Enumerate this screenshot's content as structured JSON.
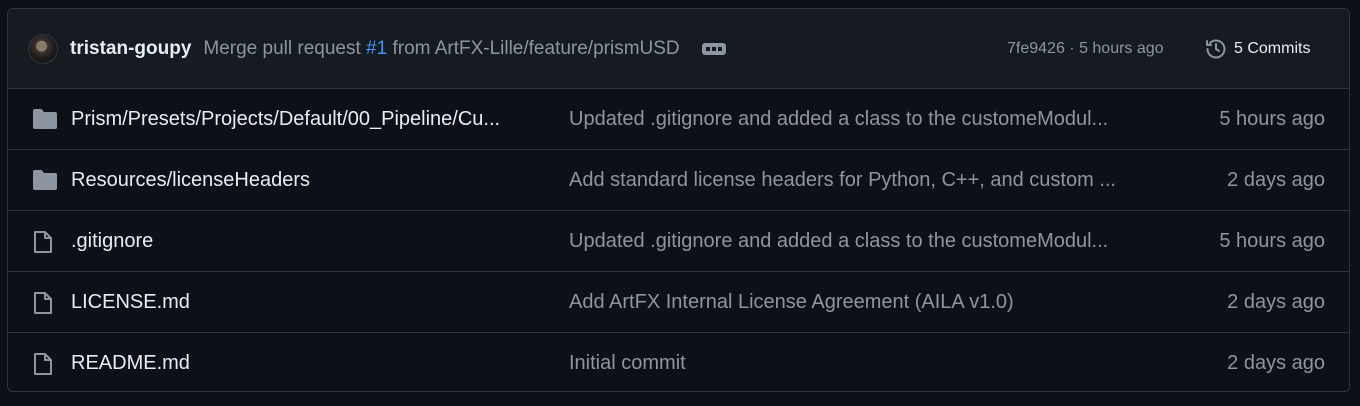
{
  "commit_header": {
    "author": "tristan-goupy",
    "message_prefix": "Merge pull request ",
    "pr_number": "#1",
    "message_suffix": " from ArtFX-Lille/feature/prismUSD",
    "sha": "7fe9426",
    "separator": " · ",
    "time": "5 hours ago",
    "commits_label": "5 Commits",
    "icons": {
      "avatar": "user-avatar",
      "more": "ellipsis-icon",
      "history": "history-icon"
    }
  },
  "files": [
    {
      "type": "folder",
      "icon": "folder-icon",
      "name": "Prism/Presets/Projects/Default/00_Pipeline/Cu...",
      "message": "Updated .gitignore and added a class to the customeModul...",
      "age": "5 hours ago"
    },
    {
      "type": "folder",
      "icon": "folder-icon",
      "name": "Resources/licenseHeaders",
      "message": "Add standard license headers for Python, C++, and custom ...",
      "age": "2 days ago"
    },
    {
      "type": "file",
      "icon": "file-icon",
      "name": ".gitignore",
      "message": "Updated .gitignore and added a class to the customeModul...",
      "age": "5 hours ago"
    },
    {
      "type": "file",
      "icon": "file-icon",
      "name": "LICENSE.md",
      "message": "Add ArtFX Internal License Agreement (AILA v1.0)",
      "age": "2 days ago"
    },
    {
      "type": "file",
      "icon": "file-icon",
      "name": "README.md",
      "message": "Initial commit",
      "age": "2 days ago"
    }
  ],
  "colors": {
    "background": "#0d1117",
    "header": "#161b22",
    "border": "#30363d",
    "text": "#e6edf3",
    "muted": "#8d96a0",
    "link": "#4493f8"
  }
}
